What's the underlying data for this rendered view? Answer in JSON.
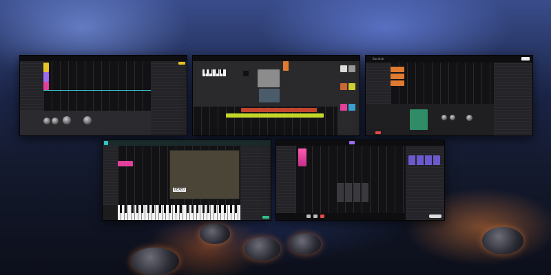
{
  "screens": {
    "daw1": {
      "label": ""
    },
    "daw2": {
      "label": ""
    },
    "daw3": {
      "label": "Bandlab",
      "center_title": ""
    },
    "daw4": {
      "synth_name": "DEXED"
    },
    "daw5": {
      "label": ""
    }
  },
  "colors": {
    "accent_yellow": "#e8c22a",
    "accent_pink": "#e0409a",
    "accent_orange": "#f08a2a",
    "accent_green": "#4fbf78",
    "accent_teal": "#35c2c8",
    "accent_purple": "#9b6cf0"
  }
}
